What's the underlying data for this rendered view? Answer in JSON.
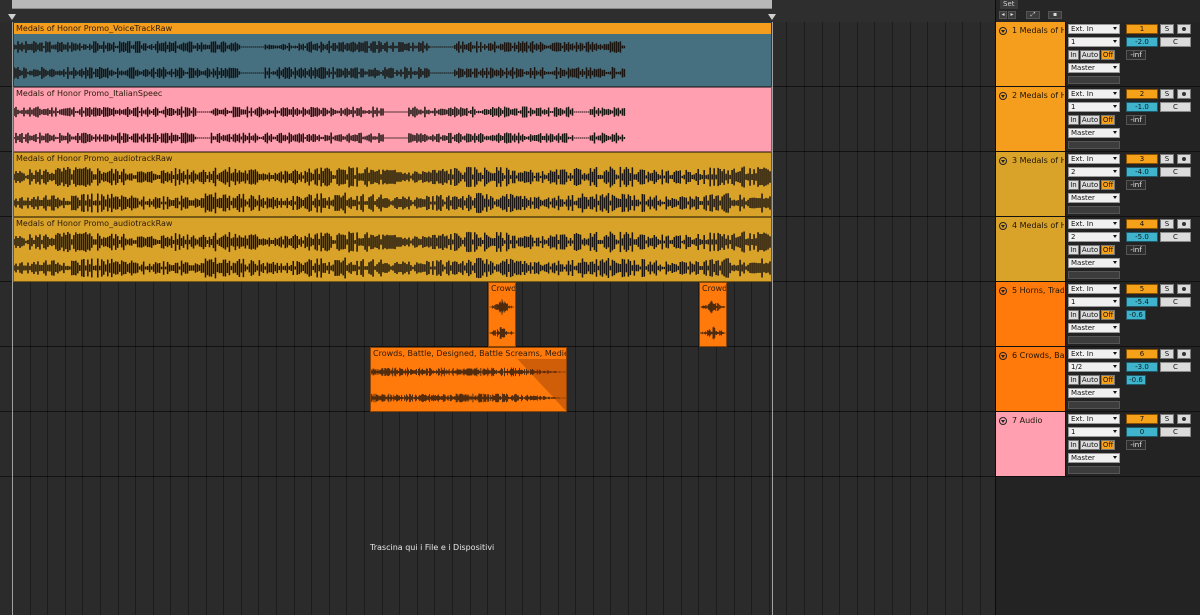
{
  "mixer_header": {
    "set_label": "Set"
  },
  "drop_hint": "Trascina qui i File e i Dispositivi",
  "colors": {
    "blue_clip": "#466f80",
    "orange": "#f59d1c",
    "pink": "#ff9fb0",
    "gold": "#d9a32a",
    "deep_orange": "#ff7a0b",
    "lane_bg": "#2b2b2b"
  },
  "tracks": [
    {
      "clip_title": "Medals of Honor Promo_VoiceTrackRaw",
      "mixer_name": "1 Medals of H",
      "input": "Ext. In",
      "channel": "1",
      "monitor": [
        "In",
        "Auto",
        "Off"
      ],
      "output": "Master",
      "number": "1",
      "volume": "-2.0",
      "pan": "C",
      "send": "-inf",
      "solo": "S",
      "color": "#f59d1c"
    },
    {
      "clip_title": "Medals of Honor Promo_ItalianSpeec",
      "mixer_name": "2 Medals of H",
      "input": "Ext. In",
      "channel": "1",
      "monitor": [
        "In",
        "Auto",
        "Off"
      ],
      "output": "Master",
      "number": "2",
      "volume": "-1.0",
      "pan": "C",
      "send": "-inf",
      "solo": "S",
      "color": "#f59d1c"
    },
    {
      "clip_title": "Medals of Honor Promo_audiotrackRaw",
      "mixer_name": "3 Medals of H",
      "input": "Ext. In",
      "channel": "2",
      "monitor": [
        "In",
        "Auto",
        "Off"
      ],
      "output": "Master",
      "number": "3",
      "volume": "-4.0",
      "pan": "C",
      "send": "-inf",
      "solo": "S",
      "color": "#d9a32a"
    },
    {
      "clip_title": "Medals of Honor Promo_audiotrackRaw",
      "mixer_name": "4 Medals of H",
      "input": "Ext. In",
      "channel": "2",
      "monitor": [
        "In",
        "Auto",
        "Off"
      ],
      "output": "Master",
      "number": "4",
      "volume": "-5.0",
      "pan": "C",
      "send": "-inf",
      "solo": "S",
      "color": "#d9a32a"
    },
    {
      "clip_title": "Crowds",
      "clip_title_2": "Crowds",
      "mixer_name": "5 Horns, Trad",
      "input": "Ext. In",
      "channel": "1",
      "monitor": [
        "In",
        "Auto",
        "Off"
      ],
      "output": "Master",
      "number": "5",
      "volume": "-5.4",
      "pan": "C",
      "send": "-0.6",
      "solo": "S",
      "color": "#ff7a0b"
    },
    {
      "clip_title": "Crowds, Battle, Designed, Battle Screams, Medieval, B",
      "mixer_name": "6 Crowds, Ba",
      "input": "Ext. In",
      "channel": "1/2",
      "monitor": [
        "In",
        "Auto",
        "Off"
      ],
      "output": "Master",
      "number": "6",
      "volume": "-3.0",
      "pan": "C",
      "send": "-0.6",
      "solo": "S",
      "color": "#ff7a0b"
    },
    {
      "clip_title": "",
      "mixer_name": "7 Audio",
      "input": "Ext. In",
      "channel": "1",
      "monitor": [
        "In",
        "Auto",
        "Off"
      ],
      "output": "Master",
      "number": "7",
      "volume": "0",
      "pan": "C",
      "send": "-inf",
      "solo": "S",
      "color": "#ff9fb0"
    }
  ]
}
